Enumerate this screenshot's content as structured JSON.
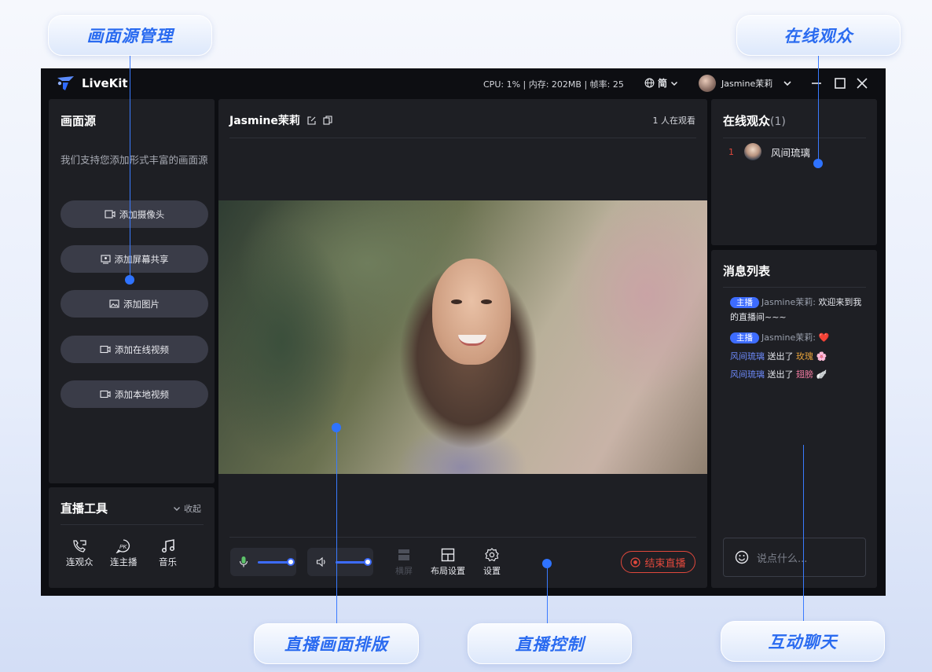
{
  "callouts": {
    "source_mgmt": "画面源管理",
    "online_viewers": "在线观众",
    "layout": "直播画面排版",
    "control": "直播控制",
    "chat": "互动聊天"
  },
  "titlebar": {
    "app_name": "LiveKit",
    "stats": "CPU:  1% |  内存:  202MB |  帧率:  25",
    "lang": "简",
    "user_name": "Jasmine茉莉"
  },
  "sources": {
    "title": "画面源",
    "description": "我们支持您添加形式丰富的画面源",
    "buttons": [
      "添加摄像头",
      "添加屏幕共享",
      "添加图片",
      "添加在线视频",
      "添加本地视频"
    ]
  },
  "tools": {
    "title": "直播工具",
    "collapse_label": "收起",
    "items": [
      "连观众",
      "连主播",
      "音乐"
    ]
  },
  "stage": {
    "room_title": "Jasmine茉莉",
    "viewer_count": "1 人在观看"
  },
  "controls": {
    "mic_level": 1.0,
    "speaker_level": 1.0,
    "landscape": "横屏",
    "layout_settings": "布局设置",
    "settings": "设置",
    "end_live": "结束直播"
  },
  "audience": {
    "title": "在线观众",
    "count": "(1)",
    "list": [
      {
        "rank": "1",
        "name": "风间琉璃"
      }
    ]
  },
  "messages": {
    "title": "消息列表",
    "host_tag": "主播",
    "items": [
      {
        "user": "Jasmine茉莉:",
        "text": "欢迎来到我的直播间~~~"
      },
      {
        "user": "Jasmine茉莉:",
        "text": "❤️"
      },
      {
        "user": "风间琉璃",
        "verb": "送出了",
        "gift": "玫瑰",
        "emoji": "🌸"
      },
      {
        "user": "风间琉璃",
        "verb": "送出了",
        "gift": "翅膀",
        "emoji": "🪽"
      }
    ],
    "input_placeholder": "说点什么..."
  },
  "colors": {
    "accent": "#3d6cff",
    "danger": "#e0483c",
    "panel": "#1e1f24",
    "window": "#0d0e12"
  }
}
